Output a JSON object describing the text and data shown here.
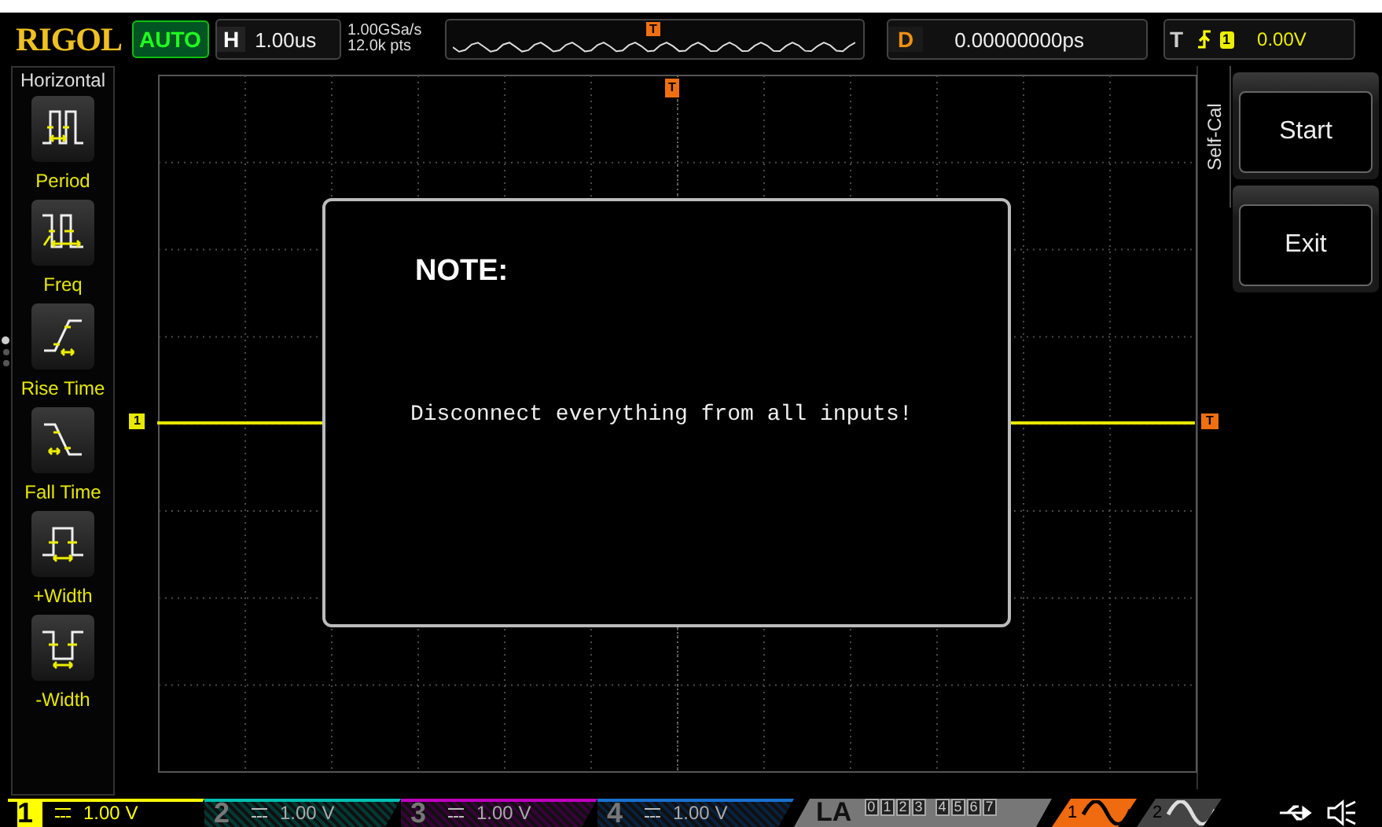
{
  "header": {
    "brand": "RIGOL",
    "run_status": "AUTO",
    "timebase": {
      "label": "H",
      "value": "1.00us"
    },
    "sample_rate": "1.00GSa/s",
    "memory_depth": "12.0k pts",
    "trigger_position": "T",
    "delay": {
      "label": "D",
      "value": "0.00000000ps"
    },
    "trigger": {
      "label": "T",
      "channel": "1",
      "level": "0.00V"
    }
  },
  "sidebar": {
    "title": "Horizontal",
    "pages": [
      {
        "selected": true
      },
      {
        "selected": false
      },
      {
        "selected": false
      }
    ],
    "items": [
      {
        "label": "Period",
        "kind": "period"
      },
      {
        "label": "Freq",
        "kind": "freq"
      },
      {
        "label": "Rise Time",
        "kind": "rise"
      },
      {
        "label": "Fall Time",
        "kind": "fall"
      },
      {
        "label": "+Width",
        "kind": "pwidth"
      },
      {
        "label": "-Width",
        "kind": "nwidth"
      }
    ]
  },
  "screen": {
    "channel_marker": "1",
    "trigger_level_marker": "T",
    "trigger_marker": "T"
  },
  "dialog": {
    "title": "NOTE:",
    "message": "Disconnect everything from all inputs!"
  },
  "menu": {
    "title": "Self-Cal",
    "buttons": [
      "Start",
      "Exit"
    ]
  },
  "channels": [
    {
      "number": "1",
      "scale": "1.00 V",
      "active": true,
      "color": "#ffff00"
    },
    {
      "number": "2",
      "scale": "1.00 V",
      "active": false,
      "color": "#00c0b0"
    },
    {
      "number": "3",
      "scale": "1.00 V",
      "active": false,
      "color": "#c000c0"
    },
    {
      "number": "4",
      "scale": "1.00 V",
      "active": false,
      "color": "#1a70d0"
    }
  ],
  "logic_analyzer": {
    "label": "LA",
    "digits": [
      "0",
      "1",
      "2",
      "3",
      "4",
      "5",
      "6",
      "7"
    ]
  },
  "sources": [
    {
      "number": "1",
      "selected": true
    },
    {
      "number": "2",
      "selected": false
    }
  ]
}
